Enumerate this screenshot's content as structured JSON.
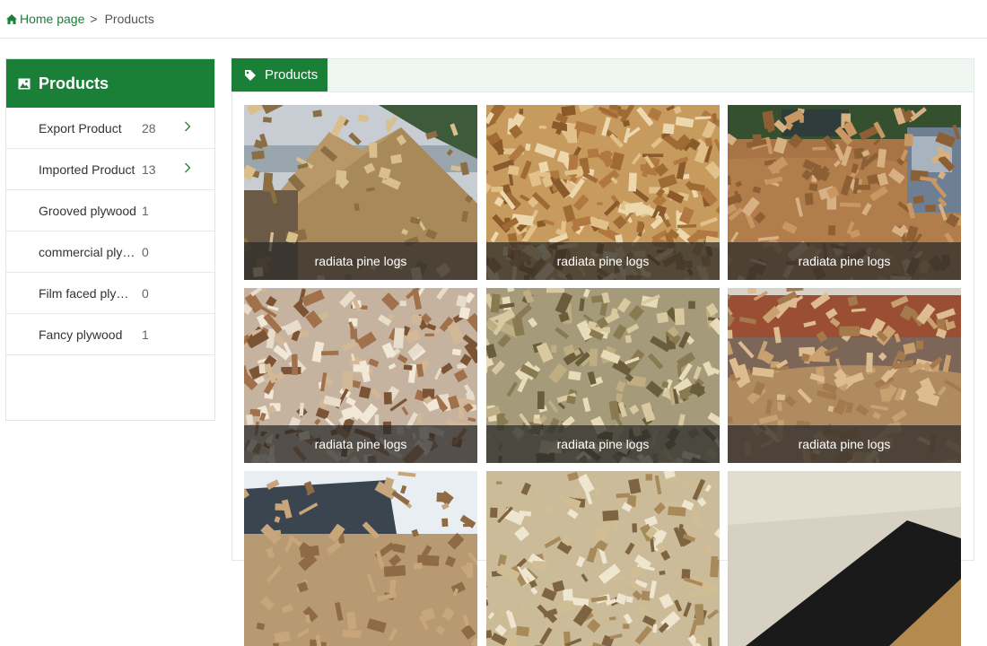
{
  "breadcrumb": {
    "home": "Home page",
    "separator": ">",
    "current": "Products"
  },
  "sidebar": {
    "title": "Products",
    "items": [
      {
        "label": "Export Product",
        "count": "28",
        "has_children": true
      },
      {
        "label": "Imported Product",
        "count": "13",
        "has_children": true
      },
      {
        "label": "Grooved plywood",
        "count": "1",
        "has_children": false
      },
      {
        "label": "commercial plywood",
        "count": "0",
        "has_children": false
      },
      {
        "label": "Film faced plywood",
        "count": "0",
        "has_children": false
      },
      {
        "label": "Fancy plywood",
        "count": "1",
        "has_children": false
      }
    ]
  },
  "main": {
    "tab_label": "Products",
    "products": [
      {
        "caption": "radiata pine logs",
        "image": "wood-chip-pile-by-sea"
      },
      {
        "caption": "radiata pine logs",
        "image": "wood-chips-closeup"
      },
      {
        "caption": "radiata pine logs",
        "image": "excavator-and-truck-on-chips"
      },
      {
        "caption": "radiata pine logs",
        "image": "wood-chips-heap-closeup"
      },
      {
        "caption": "radiata pine logs",
        "image": "wood-chips-in-bag"
      },
      {
        "caption": "radiata pine logs",
        "image": "ship-hold-with-chips"
      },
      {
        "caption": "",
        "image": "ship-by-shore"
      },
      {
        "caption": "",
        "image": "wood-chips-pieces"
      },
      {
        "caption": "",
        "image": "film-faced-plywood-sheet"
      }
    ]
  },
  "colors": {
    "accent": "#1a7f37",
    "header_bg": "#f0f6f1",
    "caption_bg": "#282828"
  }
}
